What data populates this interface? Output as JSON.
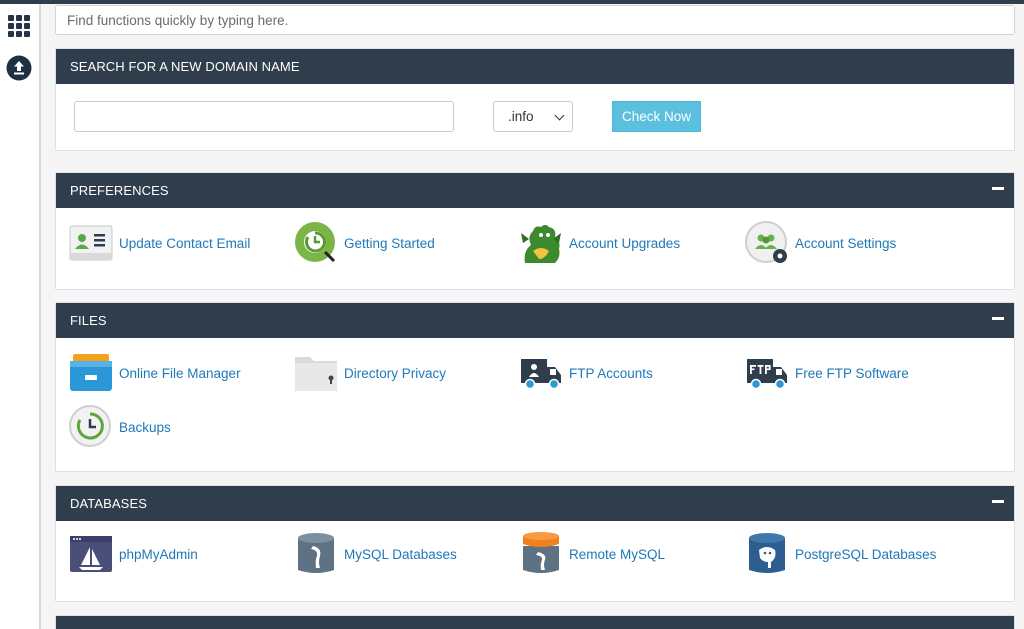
{
  "search": {
    "placeholder": "Find functions quickly by typing here."
  },
  "domain_search": {
    "title": "SEARCH FOR A NEW DOMAIN NAME",
    "tld_selected": ".info",
    "button_label": "Check Now"
  },
  "preferences": {
    "title": "PREFERENCES",
    "items": [
      {
        "label": "Update Contact Email",
        "icon": "contact-card-icon"
      },
      {
        "label": "Getting Started",
        "icon": "getting-started-icon"
      },
      {
        "label": "Account Upgrades",
        "icon": "dragon-icon"
      },
      {
        "label": "Account Settings",
        "icon": "account-settings-icon"
      }
    ]
  },
  "files": {
    "title": "FILES",
    "items": [
      {
        "label": "Online File Manager",
        "icon": "file-manager-icon"
      },
      {
        "label": "Directory Privacy",
        "icon": "folder-lock-icon"
      },
      {
        "label": "FTP Accounts",
        "icon": "ftp-truck-icon"
      },
      {
        "label": "Free FTP Software",
        "icon": "ftp-software-icon"
      },
      {
        "label": "Backups",
        "icon": "backup-clock-icon"
      }
    ]
  },
  "databases": {
    "title": "DATABASES",
    "items": [
      {
        "label": "phpMyAdmin",
        "icon": "phpmyadmin-icon"
      },
      {
        "label": "MySQL Databases",
        "icon": "mysql-icon"
      },
      {
        "label": "Remote MySQL",
        "icon": "remote-mysql-icon"
      },
      {
        "label": "PostgreSQL Databases",
        "icon": "postgresql-icon"
      }
    ]
  },
  "colors": {
    "header": "#2f3d4c",
    "link": "#1e78b9",
    "button": "#5bc0de"
  }
}
